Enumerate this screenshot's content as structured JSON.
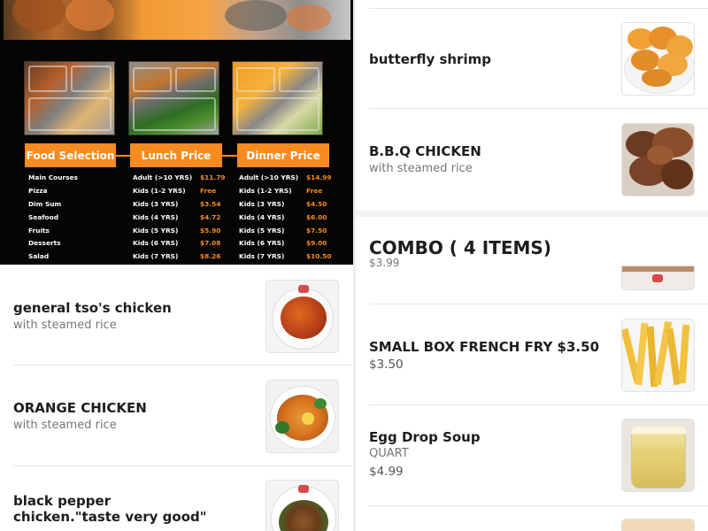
{
  "promo": {
    "headers": {
      "food": "Food Selection",
      "lunch": "Lunch Price",
      "dinner": "Dinner Price"
    },
    "food_items": [
      "Main Courses",
      "Pizza",
      "Dim Sum",
      "Seafood",
      "Fruits",
      "Desserts",
      "Salad"
    ],
    "lunch_labels": [
      "Adult (>10 YRS)",
      "Kids (1-2 YRS)",
      "Kids (3 YRS)",
      "Kids (4 YRS)",
      "Kids (5 YRS)",
      "Kids (6 YRS)",
      "Kids (7 YRS)"
    ],
    "lunch_prices": [
      "$11.79",
      "Free",
      "$3.54",
      "$4.72",
      "$5.90",
      "$7.08",
      "$8.26"
    ],
    "dinner_labels": [
      "Adult (>10 YRS)",
      "Kids (1-2 YRS)",
      "Kids (3 YRS)",
      "Kids (4 YRS)",
      "Kids (5 YRS)",
      "Kids (6 YRS)",
      "Kids (7 YRS)"
    ],
    "dinner_prices": [
      "$14.99",
      "Free",
      "$4.50",
      "$6.00",
      "$7.50",
      "$9.00",
      "$10.50"
    ],
    "accent": "#f68b1f"
  },
  "left_items": [
    {
      "name": "general tso's chicken",
      "subtitle": "with steamed rice"
    },
    {
      "name": "ORANGE CHICKEN",
      "subtitle": "with steamed rice"
    },
    {
      "name": "black pepper chicken.\"taste very good\""
    }
  ],
  "right_items": [
    {
      "name": "butterfly shrimp"
    },
    {
      "name": "B.B.Q CHICKEN",
      "subtitle": "with steamed rice"
    }
  ],
  "combo": {
    "title": "COMBO ( 4 ITEMS)",
    "partial_price": "$3.99",
    "items": [
      {
        "name": "SMALL BOX FRENCH FRY  $3.50",
        "price": "$3.50"
      },
      {
        "name": "Egg Drop Soup",
        "subtitle": "QUART",
        "price": "$4.99"
      }
    ]
  }
}
